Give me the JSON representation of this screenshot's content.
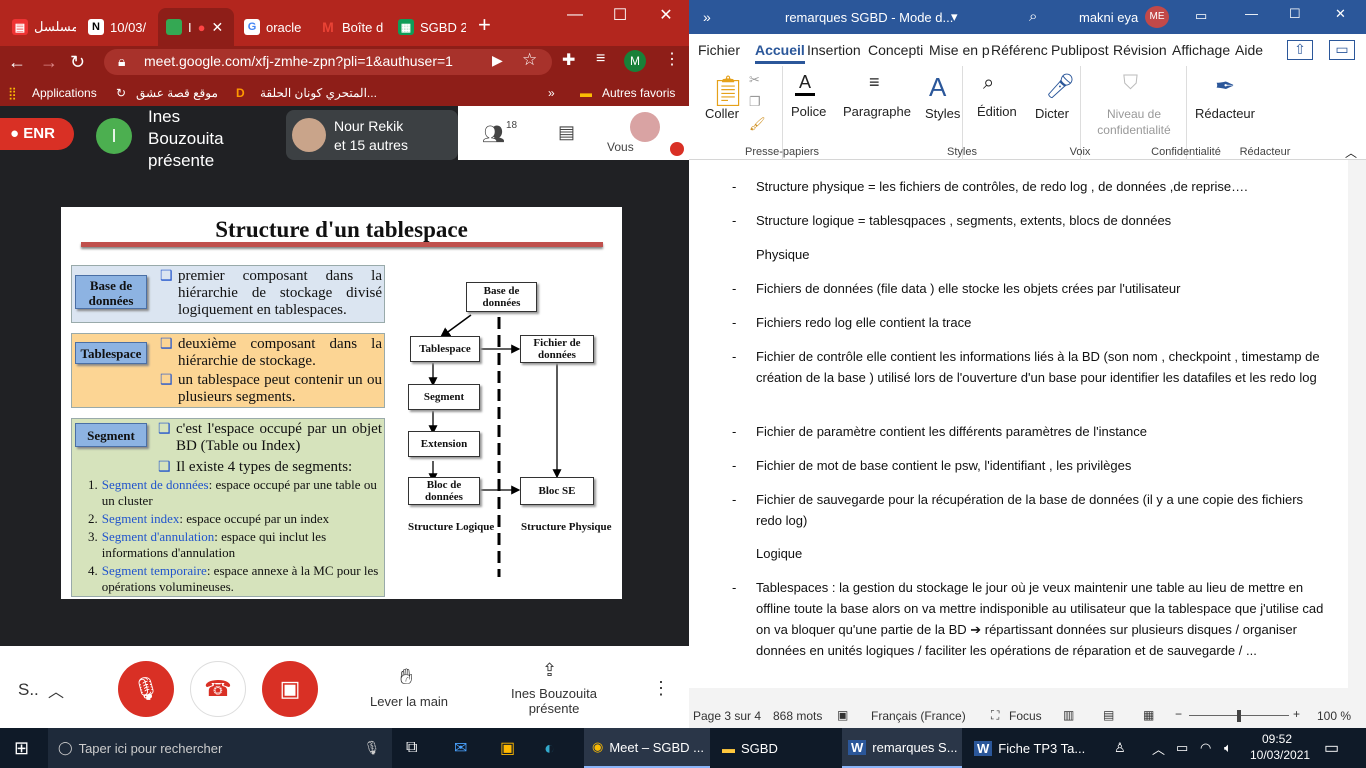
{
  "browser": {
    "tabs": [
      {
        "label": "مسلسل"
      },
      {
        "label": "10/03/"
      },
      {
        "label": "I"
      },
      {
        "label": "oracle"
      },
      {
        "label": "Boîte d"
      },
      {
        "label": "SGBD 2"
      }
    ],
    "new_tab": "+",
    "url": "meet.google.com/xfj-zmhe-zpn?pli=1&authuser=1",
    "profile": "M",
    "bookmarks": {
      "apps": "Applications",
      "b1": "موقع قصة عشق",
      "b2": "المتحري كونان الحلقة...",
      "more": "»",
      "other": "Autres favoris"
    }
  },
  "meet": {
    "rec": "ENR",
    "presenter_initial": "I",
    "presenter": "Ines Bouzouita présente",
    "participants_name": "Nour Rekik",
    "participants_more": "et 15 autres",
    "count": "18",
    "you": "Vous",
    "controls": {
      "details": "S..",
      "raise_hand": "Lever la main",
      "presenting": "Ines Bouzouita présente"
    }
  },
  "slide": {
    "title": "Structure d'un tablespace",
    "base_label": "Base de données",
    "base_text": "premier composant dans la hiérarchie de stockage divisé logiquement en tablespaces.",
    "ts_label": "Tablespace",
    "ts_text1": "deuxième composant dans la hiérarchie de stockage.",
    "ts_text2": "un tablespace peut contenir un ou plusieurs segments.",
    "seg_label": "Segment",
    "seg_text1": "c'est l'espace occupé par un objet BD (Table ou Index)",
    "seg_text2": "Il existe 4 types de segments:",
    "items": [
      {
        "num": "1.",
        "name": "Segment de données",
        "desc": ": espace occupé par une table ou un cluster"
      },
      {
        "num": "2.",
        "name": "Segment index",
        "desc": ": espace occupé par un index"
      },
      {
        "num": "3.",
        "name": "Segment d'annulation",
        "desc": ": espace qui inclut les informations d'annulation"
      },
      {
        "num": "4.",
        "name": "Segment temporaire",
        "desc": ": espace annexe à la MC pour les opérations volumineuses."
      }
    ],
    "diagram": {
      "base": "Base de données",
      "tablespace": "Tablespace",
      "fichier": "Fichier de données",
      "segment": "Segment",
      "extension": "Extension",
      "bloc": "Bloc de données",
      "blocse": "Bloc SE",
      "logique": "Structure Logique",
      "physique": "Structure Physique"
    }
  },
  "word": {
    "title": "remarques SGBD - Mode d...",
    "user": "makni eya",
    "initials": "ME",
    "tabs": [
      "Fichier",
      "Accueil",
      "Insertion",
      "Concepti",
      "Mise en p",
      "Référenc",
      "Publipost",
      "Révision",
      "Affichage",
      "Aide"
    ],
    "ribbon": {
      "coller": "Coller",
      "police": "Police",
      "paragraphe": "Paragraphe",
      "styles": "Styles",
      "edition": "Édition",
      "dicter": "Dicter",
      "niveau": "Niveau de confidentialité",
      "redacteur": "Rédacteur",
      "g_presse": "Presse-papiers",
      "g_styles": "Styles",
      "g_voix": "Voix",
      "g_conf": "Confidentialité",
      "g_red": "Rédacteur"
    },
    "doc": {
      "l1": "Structure physique = les fichiers de contrôles, de redo log , de données ,de reprise….",
      "l2": "Structure logique = tablesqpaces , segments, extents, blocs de données",
      "h1": "Physique",
      "l3": "Fichiers de données (file data ) elle stocke les objets crées par l'utilisateur",
      "l4": "Fichiers redo log elle contient la trace",
      "l5": "Fichier de contrôle elle contient les informations liés à la BD (son nom , checkpoint , timestamp de création de la base ) utilisé lors de l'ouverture d'un base pour identifier les datafiles et les redo log",
      "l6": "Fichier de paramètre contient les différents paramètres de l'instance",
      "l7": "Fichier de mot de base contient le psw, l'identifiant , les privilèges",
      "l8": "Fichier de sauvegarde pour la récupération de la base de données (il y a une copie des fichiers redo log)",
      "h2": "Logique",
      "l9": "Tablespaces : la gestion du stockage le jour où je veux maintenir une table au lieu de mettre en offline toute la base alors on va mettre indisponible au utilisateur que la tablespace que j'utilise cad on va bloquer qu'une partie de la BD ➔ répartissant données sur plusieurs disques / organiser données en unités logiques / faciliter les opérations de réparation et de sauvegarde / ..."
    },
    "status": {
      "page": "Page 3 sur 4",
      "words": "868 mots",
      "lang": "Français (France)",
      "focus": "Focus",
      "zoom": "100 %"
    }
  },
  "taskbar": {
    "search": "Taper ici pour rechercher",
    "t1": "Meet – SGBD ...",
    "t2": "SGBD",
    "t3": "remarques S...",
    "t4": "Fiche TP3 Ta...",
    "time": "09:52",
    "date": "10/03/2021"
  }
}
